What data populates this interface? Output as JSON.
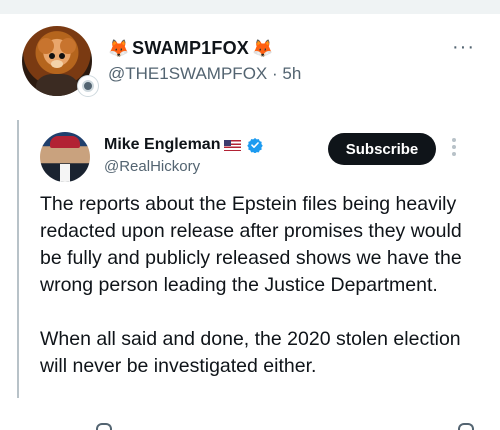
{
  "post": {
    "display_name": "SWAMP1FOX",
    "prefix_emoji": "🦊",
    "suffix_emoji": "🦊",
    "handle": "@THE1SWAMPFOX",
    "time": "5h",
    "separator": "·",
    "more_label": "···"
  },
  "quote": {
    "display_name": "Mike Engleman",
    "handle": "@RealHickory",
    "subscribe_label": "Subscribe",
    "text": "The reports about the Epstein files being heavily redacted upon release after promises they would be fully and publicly released shows we have the wrong person leading the Justice Department.\n\nWhen all said and done, the 2020 stolen election will never be investigated either."
  },
  "colors": {
    "verified_blue": "#1d9bf0",
    "subscribe_bg": "#0f1419",
    "secondary_text": "#536471"
  }
}
